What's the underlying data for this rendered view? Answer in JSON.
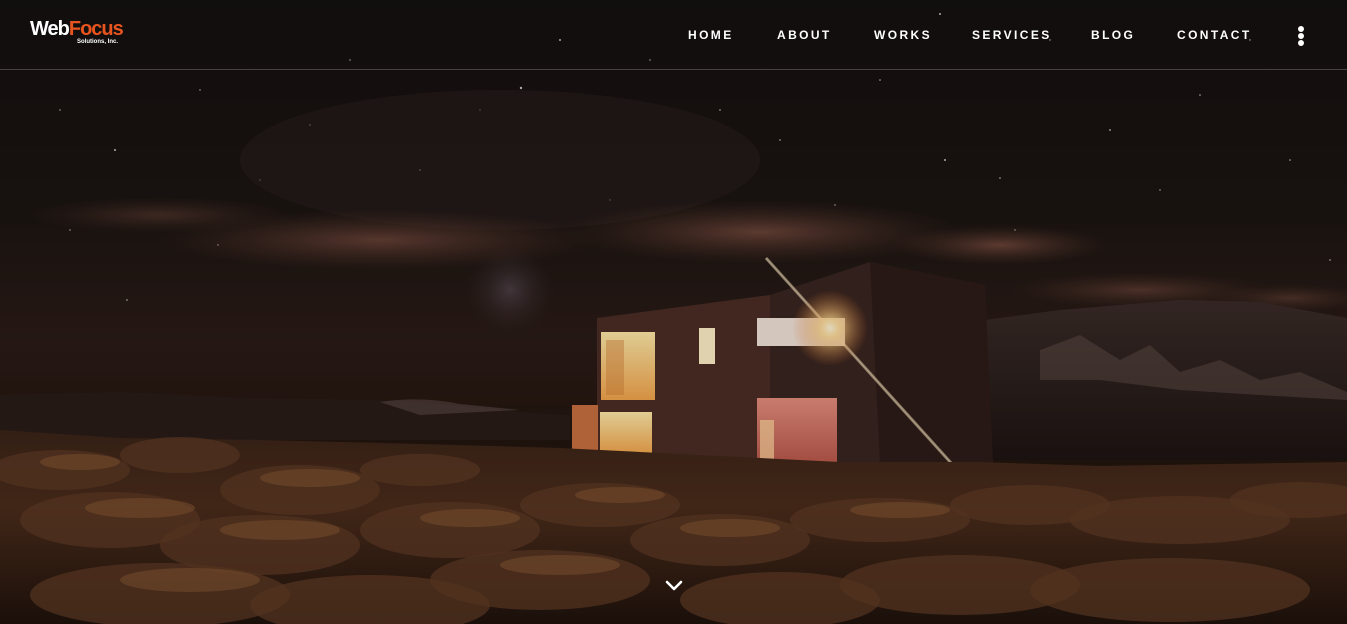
{
  "logo": {
    "brand_part1": "Web",
    "brand_part2": "Focus",
    "tagline": "Solutions, Inc.",
    "accent_color": "#e8541e"
  },
  "nav": {
    "items": [
      {
        "label": "HOME"
      },
      {
        "label": "ABOUT"
      },
      {
        "label": "WORKS"
      },
      {
        "label": "SERVICES"
      },
      {
        "label": "BLOG"
      },
      {
        "label": "CONTACT"
      }
    ],
    "menu_icon": "vertical-dots-icon"
  },
  "hero": {
    "image": "night-sky-house-landscape",
    "scroll_icon": "chevron-down-icon"
  }
}
